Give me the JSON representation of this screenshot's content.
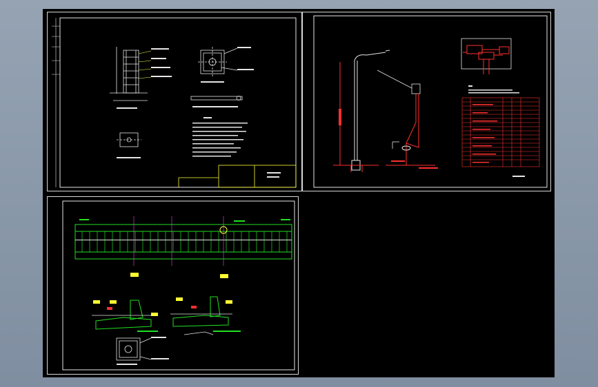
{
  "canvas": {
    "background": "#000000",
    "frame_color": "#d8d8d8"
  },
  "sheets": [
    {
      "id": "sheet-1",
      "content": "foundation-and-section-details"
    },
    {
      "id": "sheet-2",
      "content": "street-light-elevation-and-wiring"
    },
    {
      "id": "sheet-3",
      "content": "bridge-railing-elevation"
    }
  ],
  "colors": {
    "line_white": "#e6e6e6",
    "line_red": "#ff3030",
    "line_green": "#22e022",
    "line_yellow": "#ffff33",
    "line_magenta": "#ff40ff",
    "line_cyan": "#30e0e0"
  }
}
